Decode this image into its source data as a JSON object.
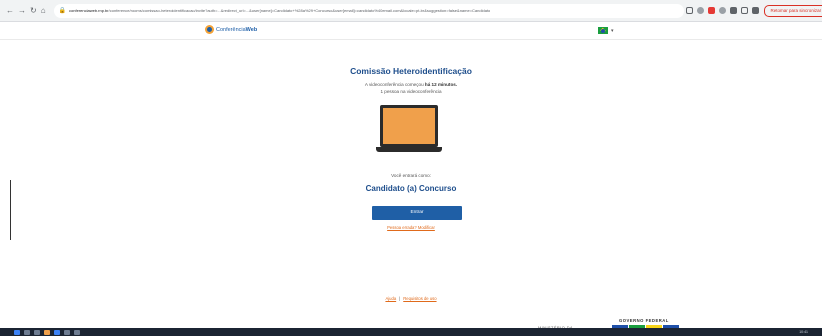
{
  "browser": {
    "back_icon": "back-arrow-icon",
    "forward_icon": "forward-arrow-icon",
    "reload_icon": "reload-icon",
    "home_icon": "home-icon",
    "url_host": "conferenciaweb.rnp.br",
    "url_path": "/conference/rooms/comissao-heteroidentificacao/invite?auth=...&redirect_url=...&user[name]=Candidato+%28a%29+Concurso&user[email]=candidato%40email.com&locale=pt-br&suggestion=false&name=Candidato",
    "pause_button": "Retomar para sincronizar"
  },
  "header": {
    "logo_text_light": "Conferência",
    "logo_text_bold": "Web",
    "language_caret": "▾"
  },
  "main": {
    "title": "Comissão Heteroidentificação",
    "started_prefix": "A videoconferência começou ",
    "started_time": "há 12 minutos.",
    "people_count": "1 pessoa na videoconferência",
    "enter_as": "Você entrará como:",
    "candidate_name": "Candidato (a) Concurso",
    "enter_button": "Entrar",
    "modify_link": "Pessoa errada? Modificar"
  },
  "footer": {
    "help_link": "Ajuda",
    "separator": "|",
    "terms_link": "Requisitos de uso",
    "gov_federal": "GOVERNO FEDERAL",
    "ministerio": "MINISTÉRIO DA"
  },
  "taskbar": {
    "clock": "10:41"
  },
  "colors": {
    "brand_blue": "#1e4e8c",
    "button_blue": "#1f5fa6",
    "link_orange": "#e06a1b",
    "laptop_screen": "#f0a04b"
  }
}
